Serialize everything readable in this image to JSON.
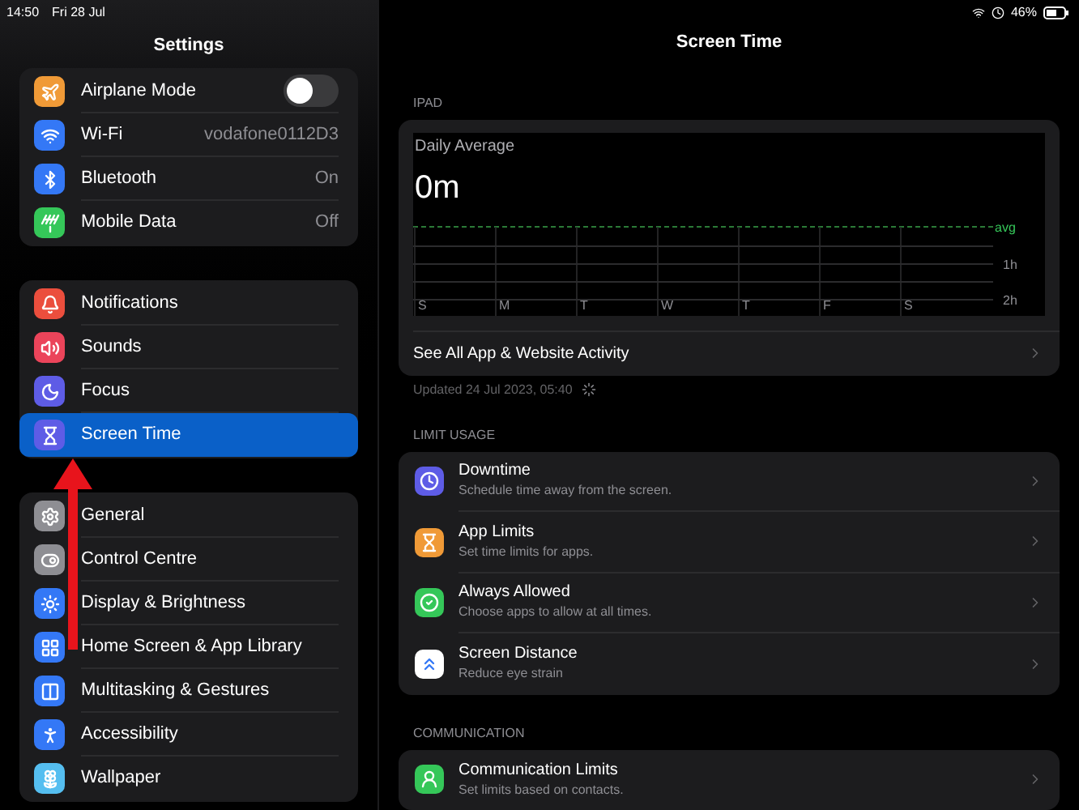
{
  "status_bar": {
    "time": "14:50",
    "date": "Fri 28 Jul",
    "battery": "46%"
  },
  "sidebar": {
    "title": "Settings",
    "groups": [
      {
        "items": [
          {
            "label": "Airplane Mode",
            "color": "#f09a37",
            "kind": "toggle",
            "on": false,
            "selected": false
          },
          {
            "label": "Wi-Fi",
            "color": "#3478f6",
            "kind": "value",
            "value": "vodafone0112D3",
            "selected": false
          },
          {
            "label": "Bluetooth",
            "color": "#3478f6",
            "kind": "value",
            "value": "On",
            "selected": false
          },
          {
            "label": "Mobile Data",
            "color": "#35c759",
            "kind": "value",
            "value": "Off",
            "selected": false
          }
        ]
      },
      {
        "items": [
          {
            "label": "Notifications",
            "color": "#eb4e3d",
            "kind": "link",
            "selected": false
          },
          {
            "label": "Sounds",
            "color": "#eb445a",
            "kind": "link",
            "selected": false
          },
          {
            "label": "Focus",
            "color": "#5e5ce6",
            "kind": "link",
            "selected": false
          },
          {
            "label": "Screen Time",
            "color": "#5e5ce6",
            "kind": "link",
            "selected": true
          }
        ]
      },
      {
        "items": [
          {
            "label": "General",
            "color": "#8e8e93",
            "kind": "link",
            "selected": false
          },
          {
            "label": "Control Centre",
            "color": "#8e8e93",
            "kind": "link",
            "selected": false
          },
          {
            "label": "Display & Brightness",
            "color": "#3478f6",
            "kind": "link",
            "selected": false
          },
          {
            "label": "Home Screen & App Library",
            "color": "#3478f6",
            "kind": "link",
            "selected": false
          },
          {
            "label": "Multitasking & Gestures",
            "color": "#3478f6",
            "kind": "link",
            "selected": false
          },
          {
            "label": "Accessibility",
            "color": "#3478f6",
            "kind": "link",
            "selected": false
          },
          {
            "label": "Wallpaper",
            "color": "#55bef0",
            "kind": "link",
            "selected": false
          }
        ]
      }
    ]
  },
  "detail": {
    "title": "Screen Time",
    "device_section": "IPAD",
    "daily_average": {
      "label": "Daily Average",
      "value": "0m",
      "average_label": "avg",
      "chart_data": {
        "type": "bar",
        "categories": [
          "S",
          "M",
          "T",
          "W",
          "T",
          "F",
          "S"
        ],
        "values": [
          0,
          0,
          0,
          0,
          0,
          0,
          0
        ],
        "ylim": [
          2,
          0
        ],
        "yticks": [
          {
            "value": 1,
            "label": "1h"
          },
          {
            "value": 2,
            "label": "2h"
          }
        ]
      }
    },
    "activity_link": "See All App & Website Activity",
    "updated": "Updated 24 Jul 2023, 05:40",
    "sections": [
      {
        "header": "LIMIT USAGE",
        "items": [
          {
            "title": "Downtime",
            "subtitle": "Schedule time away from the screen.",
            "color": "#5e5ce6"
          },
          {
            "title": "App Limits",
            "subtitle": "Set time limits for apps.",
            "color": "#f09a37"
          },
          {
            "title": "Always Allowed",
            "subtitle": "Choose apps to allow at all times.",
            "color": "#35c759"
          },
          {
            "title": "Screen Distance",
            "subtitle": "Reduce eye strain",
            "color": "#ffffff"
          }
        ]
      },
      {
        "header": "COMMUNICATION",
        "items": [
          {
            "title": "Communication Limits",
            "subtitle": "Set limits based on contacts.",
            "color": "#35c759"
          }
        ]
      }
    ]
  }
}
